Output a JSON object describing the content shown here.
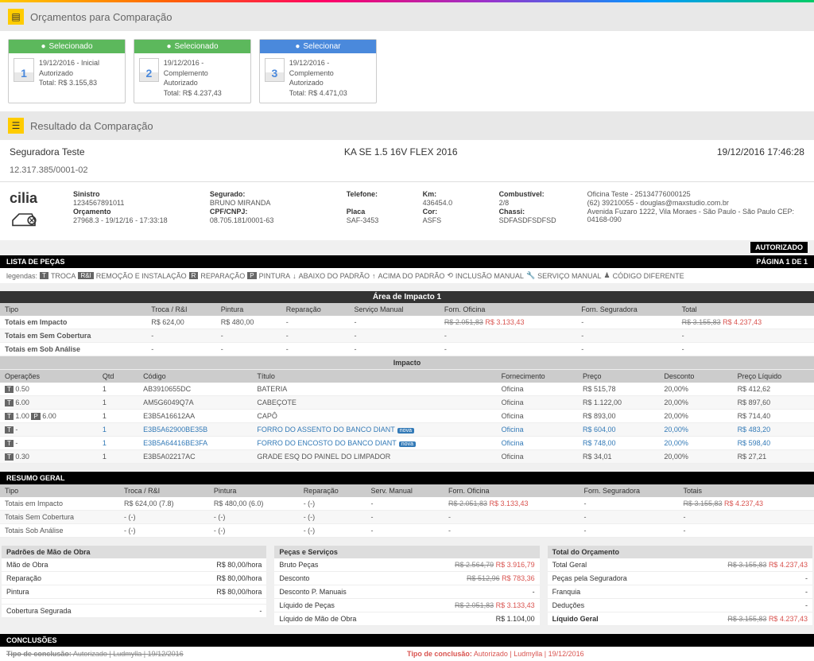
{
  "header1": "Orçamentos para Comparação",
  "cards": [
    {
      "top": "Selecionado",
      "num": "1",
      "date": "19/12/2016 - Inicial",
      "status": "Autorizado",
      "total": "Total: R$ 3.155,83",
      "cls": ""
    },
    {
      "top": "Selecionado",
      "num": "2",
      "date": "19/12/2016 - Complemento",
      "status": "Autorizado",
      "total": "Total: R$ 4.237,43",
      "cls": ""
    },
    {
      "top": "Selecionar",
      "num": "3",
      "date": "19/12/2016 - Complemento",
      "status": "Autorizado",
      "total": "Total: R$ 4.471,03",
      "cls": "blue"
    }
  ],
  "header2": "Resultado da Comparação",
  "seguradora": "Seguradora Teste",
  "vehicle": "KA SE 1.5 16V FLEX 2016",
  "datetime": "19/12/2016 17:46:28",
  "docnum": "12.317.385/0001-02",
  "info": {
    "sinistro_lbl": "Sinistro",
    "sinistro": "1234567891011",
    "orcamento_lbl": "Orçamento",
    "orcamento": "27968.3 - 19/12/16 - 17:33:18",
    "segurado_lbl": "Segurado:",
    "segurado": "BRUNO MIRANDA",
    "cpf_lbl": "CPF/CNPJ:",
    "cpf": "08.705.181/0001-63",
    "telefone_lbl": "Telefone:",
    "placa_lbl": "Placa",
    "placa": "SAF-3453",
    "km_lbl": "Km:",
    "km": "436454.0",
    "cor_lbl": "Cor:",
    "cor": "ASFS",
    "comb_lbl": "Combustível:",
    "comb": "2/8",
    "chassi_lbl": "Chassi:",
    "chassi": "SDFASDFSDFSD",
    "oficina": "Oficina Teste - 25134776000125",
    "contato": "(62) 39210055 - douglas@maxstudio.com.br",
    "endereco": "Avenida Fuzaro 1222, Vila Moraes - São Paulo - São Paulo CEP: 04168-090"
  },
  "autorizado": "AUTORIZADO",
  "lista_pecas": "LISTA DE PEÇAS",
  "pagina": "PÁGINA 1 DE 1",
  "legend_label": "legendas:",
  "legend": {
    "T": "TROCA",
    "RI": "REMOÇÃO E INSTALAÇÃO",
    "R": "REPARAÇÃO",
    "P": "PINTURA",
    "down": "ABAIXO DO PADRÃO",
    "up": "ACIMA DO PADRÃO",
    "incl": "INCLUSÃO MANUAL",
    "serv": "SERVIÇO MANUAL",
    "cod": "CÓDIGO DIFERENTE"
  },
  "area_title": "Área de Impacto 1",
  "area_cols": [
    "Tipo",
    "Troca / R&I",
    "Pintura",
    "Reparação",
    "Serviço Manual",
    "Forn. Oficina",
    "Forn. Seguradora",
    "Total"
  ],
  "area_rows": [
    {
      "tipo": "Totais em Impacto",
      "troca": "R$ 624,00",
      "pintura": "R$ 480,00",
      "rep": "-",
      "serv": "-",
      "ofi_old": "R$ 2.051,83",
      "ofi_new": "R$ 3.133,43",
      "seg": "-",
      "tot_old": "R$ 3.155,83",
      "tot_new": "R$ 4.237,43"
    },
    {
      "tipo": "Totais em Sem Cobertura",
      "troca": "-",
      "pintura": "-",
      "rep": "-",
      "serv": "-",
      "ofi_old": "-",
      "ofi_new": "",
      "seg": "-",
      "tot_old": "-",
      "tot_new": ""
    },
    {
      "tipo": "Totais em Sob Análise",
      "troca": "-",
      "pintura": "-",
      "rep": "-",
      "serv": "-",
      "ofi_old": "-",
      "ofi_new": "",
      "seg": "-",
      "tot_old": "-",
      "tot_new": ""
    }
  ],
  "impacto_sub": "Impacto",
  "det_cols": [
    "Operações",
    "Qtd",
    "Código",
    "Título",
    "Fornecimento",
    "Preço",
    "Desconto",
    "Preço Líquido"
  ],
  "det_rows": [
    {
      "op": "T",
      "opval": "0.50",
      "qtd": "1",
      "cod": "AB3910655DC",
      "tit": "BATERIA",
      "forn": "Oficina",
      "preco": "R$ 515,78",
      "desc": "20,00%",
      "liq": "R$ 412,62",
      "new": false
    },
    {
      "op": "T",
      "opval": "6.00",
      "qtd": "1",
      "cod": "AM5G6049Q7A",
      "tit": "CABEÇOTE",
      "forn": "Oficina",
      "preco": "R$ 1.122,00",
      "desc": "20,00%",
      "liq": "R$ 897,60",
      "new": false
    },
    {
      "op": "TP",
      "opval": "1.00",
      "op2": "6.00",
      "qtd": "1",
      "cod": "E3B5A16612AA",
      "tit": "CAPÔ",
      "forn": "Oficina",
      "preco": "R$ 893,00",
      "desc": "20,00%",
      "liq": "R$ 714,40",
      "new": false
    },
    {
      "op": "T",
      "opval": "-",
      "qtd": "1",
      "cod": "E3B5A62900BE35B",
      "tit": "FORRO DO ASSENTO DO BANCO DIANT",
      "forn": "Oficina",
      "preco": "R$ 604,00",
      "desc": "20,00%",
      "liq": "R$ 483,20",
      "new": true
    },
    {
      "op": "T",
      "opval": "-",
      "qtd": "1",
      "cod": "E3B5A64416BE3FA",
      "tit": "FORRO DO ENCOSTO DO BANCO DIANT",
      "forn": "Oficina",
      "preco": "R$ 748,00",
      "desc": "20,00%",
      "liq": "R$ 598,40",
      "new": true
    },
    {
      "op": "T",
      "opval": "0.30",
      "qtd": "1",
      "cod": "E3B5A02217AC",
      "tit": "GRADE ESQ DO PAINEL DO LIMPADOR",
      "forn": "Oficina",
      "preco": "R$ 34,01",
      "desc": "20,00%",
      "liq": "R$ 27,21",
      "new": false
    }
  ],
  "resumo_title": "RESUMO GERAL",
  "resumo_cols": [
    "Tipo",
    "Troca / R&I",
    "Pintura",
    "Reparação",
    "Serv. Manual",
    "Forn. Oficina",
    "Forn. Seguradora",
    "Totais"
  ],
  "resumo_rows": [
    {
      "tipo": "Totais em Impacto",
      "troca": "R$ 624,00 (7.8)",
      "pint": "R$ 480,00 (6.0)",
      "rep": "- (-)",
      "serv": "-",
      "ofi_old": "R$ 2.051,83",
      "ofi_new": "R$ 3.133,43",
      "seg": "-",
      "tot_old": "R$ 3.155,83",
      "tot_new": "R$ 4.237,43"
    },
    {
      "tipo": "Totais Sem Cobertura",
      "troca": "- (-)",
      "pint": "- (-)",
      "rep": "- (-)",
      "serv": "-",
      "ofi_old": "-",
      "ofi_new": "",
      "seg": "-",
      "tot_old": "-",
      "tot_new": ""
    },
    {
      "tipo": "Totais Sob Análise",
      "troca": "- (-)",
      "pint": "- (-)",
      "rep": "- (-)",
      "serv": "-",
      "ofi_old": "-",
      "ofi_new": "",
      "seg": "-",
      "tot_old": "-",
      "tot_new": ""
    }
  ],
  "box1": {
    "title": "Padrões de Mão de Obra",
    "rows": [
      {
        "k": "Mão de Obra",
        "v": "R$ 80,00/hora"
      },
      {
        "k": "Reparação",
        "v": "R$ 80,00/hora"
      },
      {
        "k": "Pintura",
        "v": "R$ 80,00/hora"
      },
      {
        "k": "",
        "v": ""
      },
      {
        "k": "Cobertura Segurada",
        "v": "-"
      }
    ]
  },
  "box2": {
    "title": "Peças e Serviços",
    "rows": [
      {
        "k": "Bruto Peças",
        "v_old": "R$ 2.564,79",
        "v_new": "R$ 3.916,79"
      },
      {
        "k": "Desconto",
        "v_old": "R$ 512,96",
        "v_new": "R$ 783,36"
      },
      {
        "k": "Desconto P. Manuais",
        "v": "-"
      },
      {
        "k": "Líquido de Peças",
        "v_old": "R$ 2.051,83",
        "v_new": "R$ 3.133,43"
      },
      {
        "k": "Líquido de Mão de Obra",
        "v": "R$ 1.104,00"
      }
    ]
  },
  "box3": {
    "title": "Total do Orçamento",
    "rows": [
      {
        "k": "Total Geral",
        "v_old": "R$ 3.155,83",
        "v_new": "R$ 4.237,43"
      },
      {
        "k": "Peças pela Seguradora",
        "v": "-"
      },
      {
        "k": "Franquia",
        "v": "-"
      },
      {
        "k": "Deduções",
        "v": "-"
      },
      {
        "k": "Líquido Geral",
        "bold": true,
        "v_old": "R$ 3.155,83",
        "v_new": "R$ 4.237,43"
      }
    ]
  },
  "conclusoes": "CONCLUSÕES",
  "concl_left_lbl": "Tipo de conclusão:",
  "concl_left": "Autorizado | Ludmylla | 19/12/2016",
  "concl_right_lbl": "Tipo de conclusão:",
  "concl_right": "Autorizado | Ludmylla | 19/12/2016"
}
